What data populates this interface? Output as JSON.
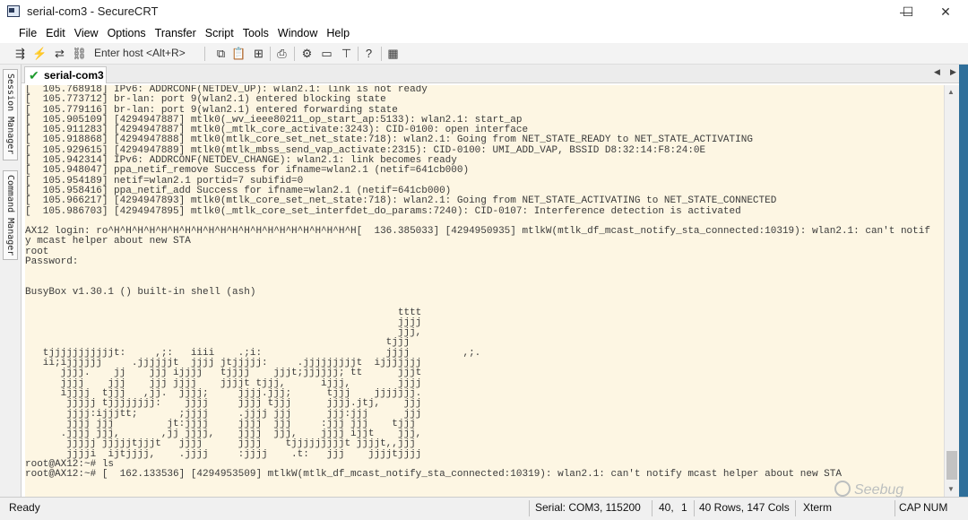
{
  "window": {
    "title": "serial-com3 - SecureCRT",
    "minimize": "—",
    "maximize": "☐",
    "close": "✕"
  },
  "menu": [
    "File",
    "Edit",
    "View",
    "Options",
    "Transfer",
    "Script",
    "Tools",
    "Window",
    "Help"
  ],
  "toolbar": {
    "host_placeholder": "Enter host <Alt+R>",
    "icons": [
      "connect-icon",
      "quick-connect-icon",
      "reconnect-icon",
      "disconnect-icon",
      "copy-icon",
      "paste-icon",
      "find-icon",
      "print-icon",
      "settings-icon",
      "keymap-icon",
      "sftp-icon",
      "help-icon",
      "screenshot-icon"
    ]
  },
  "side_tabs": {
    "session_manager": "Session Manager",
    "command_manager": "Command Manager"
  },
  "tab": {
    "label": "serial-com3",
    "prev": "◀",
    "next": "▶"
  },
  "terminal": {
    "lines": [
      "[  105.768918] IPv6: ADDRCONF(NETDEV_UP): wlan2.1: link is not ready",
      "[  105.773712] br-lan: port 9(wlan2.1) entered blocking state",
      "[  105.779116] br-lan: port 9(wlan2.1) entered forwarding state",
      "[  105.905109] [4294947887] mtlk0(_wv_ieee80211_op_start_ap:5133): wlan2.1: start_ap",
      "[  105.911283] [4294947887] mtlk0(_mtlk_core_activate:3243): CID-0100: open interface",
      "[  105.918868] [4294947888] mtlk0(mtlk_core_set_net_state:718): wlan2.1: Going from NET_STATE_READY to NET_STATE_ACTIVATING",
      "[  105.929615] [4294947889] mtlk0(mtlk_mbss_send_vap_activate:2315): CID-0100: UMI_ADD_VAP, BSSID D8:32:14:F8:24:0E",
      "[  105.942314] IPv6: ADDRCONF(NETDEV_CHANGE): wlan2.1: link becomes ready",
      "[  105.948047] ppa_netif_remove Success for ifname=wlan2.1 (netif=641cb000)",
      "[  105.954189] netif=wlan2.1 portid=7 subifid=0",
      "[  105.958416] ppa_netif_add Success for ifname=wlan2.1 (netif=641cb000)",
      "[  105.966217] [4294947893] mtlk0(mtlk_core_set_net_state:718): wlan2.1: Going from NET_STATE_ACTIVATING to NET_STATE_CONNECTED",
      "[  105.986703] [4294947895] mtlk0(_mtlk_core_set_interfdet_do_params:7240): CID-0107: Interference detection is activated",
      "",
      "AX12 login: ro^H^H^H^H^H^H^H^H^H^H^H^H^H^H^H^H^H^H^H^H^H[  136.385033] [4294950935] mtlkW(mtlk_df_mcast_notify_sta_connected:10319): wlan2.1: can't notif",
      "y mcast helper about new STA",
      "root",
      "Password:",
      "",
      "",
      "BusyBox v1.30.1 () built-in shell (ash)",
      "",
      "                                                               tttt",
      "                                                               jjjj",
      "                                                               jjj,",
      "                                                             tjjj",
      "   tjjjjjjjjjjjt:     ,;:   iiii    .;i:                     jjjj         ,;.",
      "   ii;ijjjjjj     .jjjjjjt  jjjj jtjjjjj:     .jjjjjjjjjt  ijjjjjjj",
      "      jjjj.    jj    jjj ijjjj   tjjjj    jjjt;jjjjjj; tt      jjjt",
      "      jjjj    jjj    jjj jjjj    jjjjt tjjj,      ijjj,        jjjj",
      "      ijjjj  tjjj   ,jj.  jjjj;     jjjj.jjj;      tjjj    jjjjjjj.",
      "       jjjjj tjjjjjjjj:    jjjj     jjjj tjjj      jjjj.jtj,    jjj",
      "       jjjj:ijjjtt;       ;jjjj     .jjjj jjj      jjj:jjj      jjj",
      "       jjjj jjj         jt:jjjj     jjjj  jjj     :jjj jjj    tjjj",
      "      .jjjj jjj,       ,jj jjjj,    jjjj  jjj,    jjjj ijjt    jjj,",
      "       jjjjj jjjjjtjjjt   jjjj      jjjj    tjjjjjjjjjt jjjjt,,jjj",
      "       jjjji  ijtjjjj,    .jjjj     :jjjj    .t:   jjj    jjjjtjjjj",
      "root@AX12:~# ls",
      "root@AX12:~# [  162.133536] [4294953509] mtlkW(mtlk_df_mcast_notify_sta_connected:10319): wlan2.1: can't notify mcast helper about new STA"
    ]
  },
  "status": {
    "ready": "Ready",
    "serial": "Serial: COM3, 115200",
    "row": "40,",
    "col": "1",
    "size": "40 Rows, 147 Cols",
    "term": "Xterm",
    "caps": "CAP",
    "num": "NUM"
  },
  "watermark": "Seebug"
}
